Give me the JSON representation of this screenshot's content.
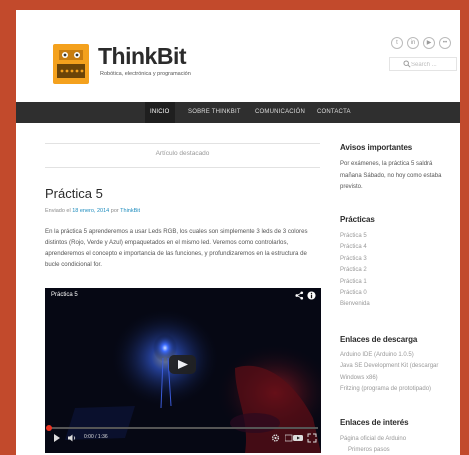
{
  "site": {
    "title": "ThinkBit",
    "tagline": "Robótica, electrónica y programación"
  },
  "social_icons": [
    "twitter-icon",
    "linkedin-icon",
    "youtube-icon",
    "flickr-icon"
  ],
  "social_labels": [
    "t",
    "in",
    "▶",
    "••"
  ],
  "search": {
    "placeholder": "Search ..."
  },
  "nav": {
    "items": [
      {
        "label": "INICIO",
        "active": true
      },
      {
        "label": "SOBRE THINKBIT",
        "active": false
      },
      {
        "label": "COMUNICACIÓN",
        "active": false
      },
      {
        "label": "CONTACTA",
        "active": false
      }
    ]
  },
  "featured": {
    "label": "Artículo destacado"
  },
  "post": {
    "title": "Práctica 5",
    "meta_prefix": "Enviado el",
    "date": "18 enero, 2014",
    "meta_by": "por",
    "author": "ThinkBit",
    "body": "En la práctica 5 aprenderemos a usar Leds RGB, los cuales son simplemente 3 leds de 3 colores distintos (Rojo, Verde y Azul) empaquetados en el mismo led. Veremos como controlarlos, aprenderemos el concepto e importancia de las funciones, y profundizaremos en la estructura de bucle condicional for."
  },
  "video": {
    "title": "Práctica 5",
    "time": "0:00 / 1:36",
    "progress": 0.01
  },
  "sidebar": {
    "notices": {
      "heading": "Avisos importantes",
      "text": "Por exámenes, la práctica 5 saldrá mañana Sábado, no hoy como estaba previsto."
    },
    "practicas": {
      "heading": "Prácticas",
      "items": [
        "Práctica 5",
        "Práctica 4",
        "Práctica 3",
        "Práctica 2",
        "Práctica 1",
        "Práctica 0",
        "Bienvenida"
      ]
    },
    "downloads": {
      "heading": "Enlaces de descarga",
      "items": [
        "Arduino IDE (Arduino 1.0.5)",
        "Java SE Development Kit (descargar Windows x86)",
        "Fritzing (programa de prototipado)"
      ]
    },
    "interest": {
      "heading": "Enlaces de interés",
      "items": [
        "Página oficial de Arduino",
        "Primeros pasos"
      ]
    }
  },
  "colors": {
    "border": "#c24a2c",
    "nav_bg": "#2f2f2f",
    "link": "#1e8cbe",
    "logo_orange": "#f4a11d"
  }
}
